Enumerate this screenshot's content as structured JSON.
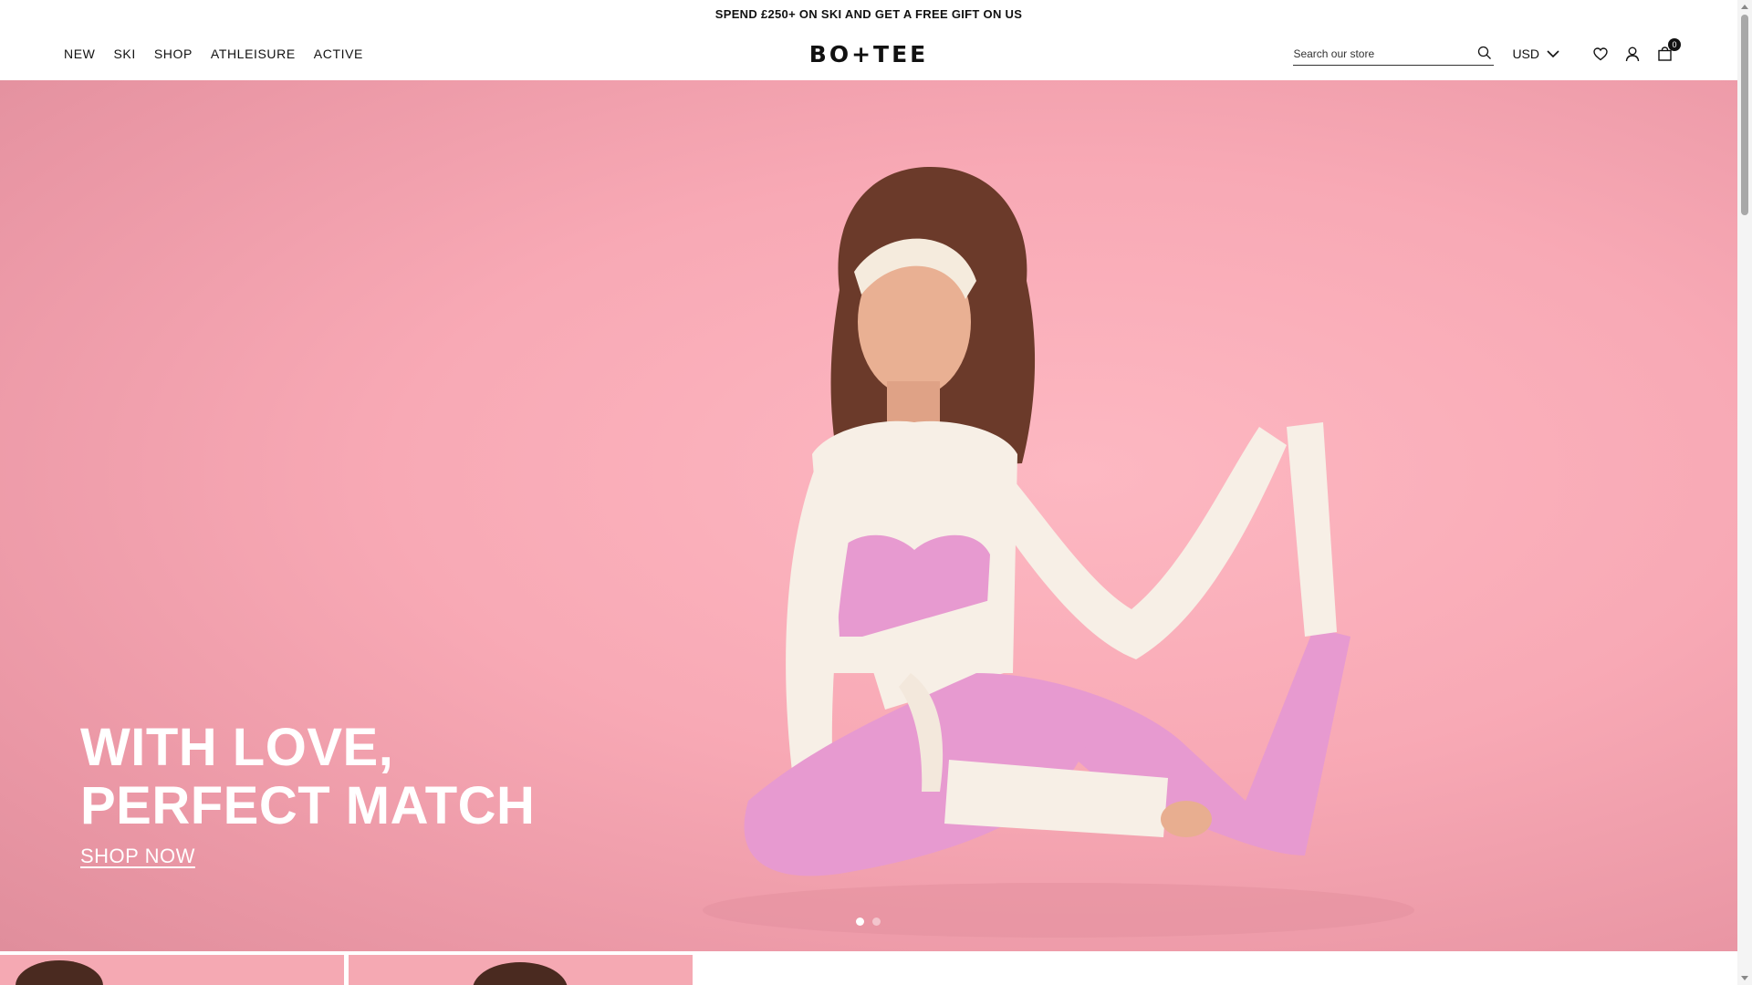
{
  "announcement": "SPEND £250+ ON SKI AND GET A FREE GIFT ON US",
  "nav": [
    "NEW",
    "SKI",
    "SHOP",
    "ATHLEISURE",
    "ACTIVE"
  ],
  "brand": "BO+TEE",
  "search": {
    "placeholder": "Search our store"
  },
  "currency": "USD",
  "cart": {
    "count": "0"
  },
  "hero": {
    "title_line1": "WITH LOVE,",
    "title_line2": "PERFECT MATCH",
    "cta": "SHOP NOW",
    "slides_total": 2,
    "active_slide": 1
  },
  "colors": {
    "hero_background": "#f8a9b5",
    "top_color": "#f7efe6",
    "leggings_color": "#e79ad0"
  },
  "icons": [
    "search-icon",
    "chevron-down-icon",
    "heart-icon",
    "user-icon",
    "shopping-bag-icon"
  ]
}
